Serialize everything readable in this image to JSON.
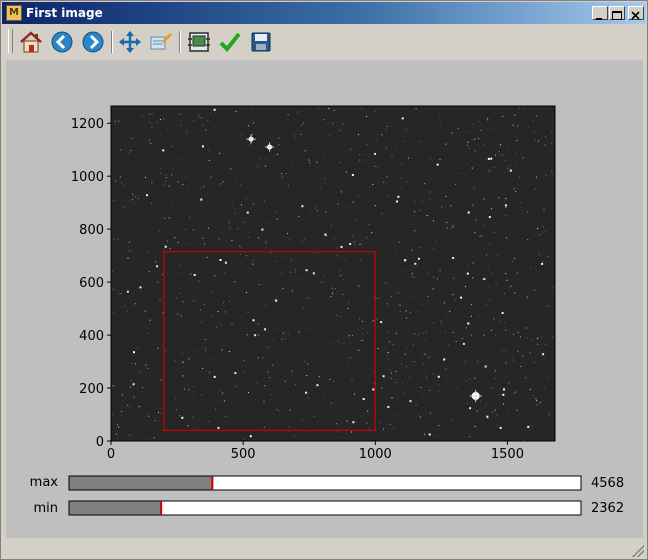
{
  "window": {
    "title": "First image",
    "app_icon_glyph": "M"
  },
  "toolbar": {
    "buttons": [
      {
        "name": "home-button",
        "icon": "home-icon"
      },
      {
        "name": "back-button",
        "icon": "back-arrow-icon"
      },
      {
        "name": "forward-button",
        "icon": "forward-arrow-icon"
      },
      {
        "name": "pan-button",
        "icon": "move-icon"
      },
      {
        "name": "zoom-button",
        "icon": "zoom-icon"
      },
      {
        "name": "configure-subplots-button",
        "icon": "subplots-icon"
      },
      {
        "name": "edit-axes-button",
        "icon": "checkmark-icon"
      },
      {
        "name": "save-button",
        "icon": "save-icon"
      }
    ]
  },
  "colors": {
    "figure_bg": "#bfbfbf",
    "image_bg": "#262626",
    "roi_stroke": "#cc0000",
    "slider_fill": "#808080",
    "slider_marker": "#cc0000"
  },
  "chart_data": {
    "type": "image",
    "xlim": [
      0,
      1680
    ],
    "ylim": [
      0,
      1265
    ],
    "xticks": [
      0,
      500,
      1000,
      1500
    ],
    "yticks": [
      0,
      200,
      400,
      600,
      800,
      1000,
      1200
    ],
    "roi": {
      "x0": 200,
      "y0": 40,
      "x1": 1000,
      "y1": 715
    },
    "bright_stars": [
      [
        1380,
        170
      ],
      [
        530,
        1140
      ],
      [
        600,
        1110
      ]
    ]
  },
  "sliders": [
    {
      "label": "max",
      "value_text": "4568",
      "fraction": 0.28
    },
    {
      "label": "min",
      "value_text": "2362",
      "fraction": 0.18
    }
  ]
}
